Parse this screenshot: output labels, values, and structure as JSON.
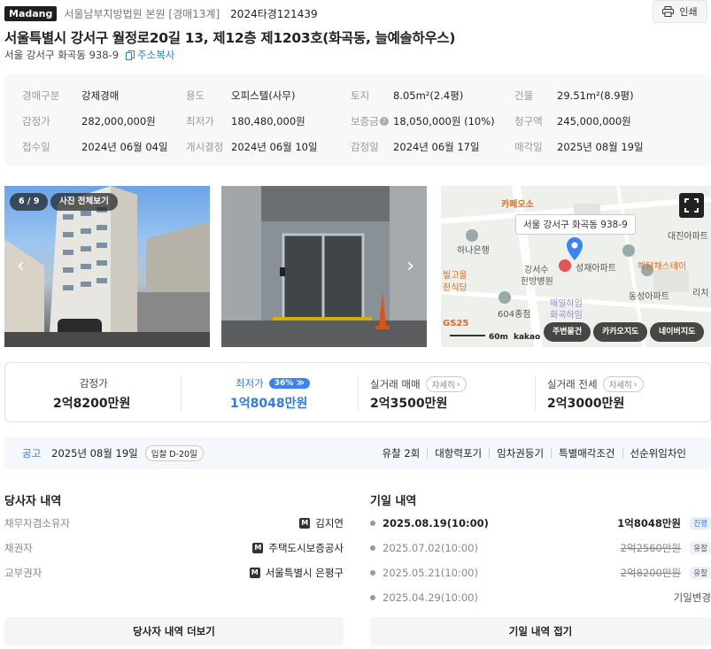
{
  "header": {
    "logo": "Madang",
    "court": "서울남부지방법원 본원 [경매13계]",
    "case_no": "2024타경121439",
    "print_label": "인쇄"
  },
  "title": "서울특별시 강서구 월정로20길 13, 제12층 제1203호(화곡동, 늘예솔하우스)",
  "sub_address": "서울 강서구 화곡동 938-9",
  "copy_address_label": "주소복사",
  "info": [
    {
      "label": "경매구분",
      "value": "강제경매"
    },
    {
      "label": "용도",
      "value": "오피스텔(사무)"
    },
    {
      "label": "토지",
      "value": "8.05m²(2.4평)"
    },
    {
      "label": "건물",
      "value": "29.51m²(8.9평)"
    },
    {
      "label": "감정가",
      "value": "282,000,000원"
    },
    {
      "label": "최저가",
      "value": "180,480,000원"
    },
    {
      "label": "보증금",
      "value": "18,050,000원 (10%)"
    },
    {
      "label": "청구액",
      "value": "245,000,000원"
    },
    {
      "label": "접수일",
      "value": "2024년 06월 04일"
    },
    {
      "label": "개시결정",
      "value": "2024년 06월 10일"
    },
    {
      "label": "감정일",
      "value": "2024년 06월 17일"
    },
    {
      "label": "매각일",
      "value": "2025년 08월 19일"
    }
  ],
  "photos": {
    "counter": "6 / 9",
    "view_all": "사진 전체보기"
  },
  "map": {
    "address_label": "서울 강서구 화곡동 938-9",
    "places": [
      "카페오소",
      "하나은행",
      "빌고을",
      "천식당",
      "강서수",
      "한방병원",
      "성재아파트",
      "해담채스테이",
      "대진아파트",
      "동성아파트",
      "리치",
      "604종점",
      "매일하임",
      "화곡하임",
      "GS25"
    ],
    "scale": "60m",
    "brand": "kakao",
    "buttons": [
      "주변물건",
      "카카오지도",
      "네이버지도"
    ]
  },
  "prices": {
    "appraisal": {
      "label": "감정가",
      "value": "2억8200만원"
    },
    "minimum": {
      "label": "최저가",
      "pct": "36%",
      "value": "1억8048만원"
    },
    "trade": {
      "label": "실거래 매매",
      "chip": "자세히",
      "value": "2억3500만원"
    },
    "jeonse": {
      "label": "실거래 전세",
      "chip": "자세히",
      "value": "2억3000만원"
    }
  },
  "notice": {
    "label": "공고",
    "date": "2025년 08월 19일",
    "dday": "입찰 D-20일",
    "tags": [
      "유찰 2회",
      "대항력포기",
      "임차권등기",
      "특별매각조건",
      "선순위임차인"
    ]
  },
  "parties": {
    "title": "당사자 내역",
    "rows": [
      {
        "role": "채무자겸소유자",
        "name": "김지연"
      },
      {
        "role": "채권자",
        "name": "주택도시보증공사"
      },
      {
        "role": "교부권자",
        "name": "서울특별시 은평구"
      }
    ],
    "badge": "M",
    "more_label": "당사자 내역 더보기"
  },
  "schedule": {
    "title": "기일 내역",
    "rows": [
      {
        "date": "2025.08.19(10:00)",
        "amount": "1억8048만원",
        "status": "진행"
      },
      {
        "date": "2025.07.02(10:00)",
        "amount": "2억2560만원",
        "status": "유찰"
      },
      {
        "date": "2025.05.21(10:00)",
        "amount": "2억8200만원",
        "status": "유찰"
      },
      {
        "date": "2025.04.29(10:00)",
        "amount": "",
        "status": "기일변경"
      }
    ],
    "fold_label": "기일 내역 접기"
  },
  "colors": {
    "accent": "#2f7be5",
    "badge_blue": "#3b82f6"
  }
}
